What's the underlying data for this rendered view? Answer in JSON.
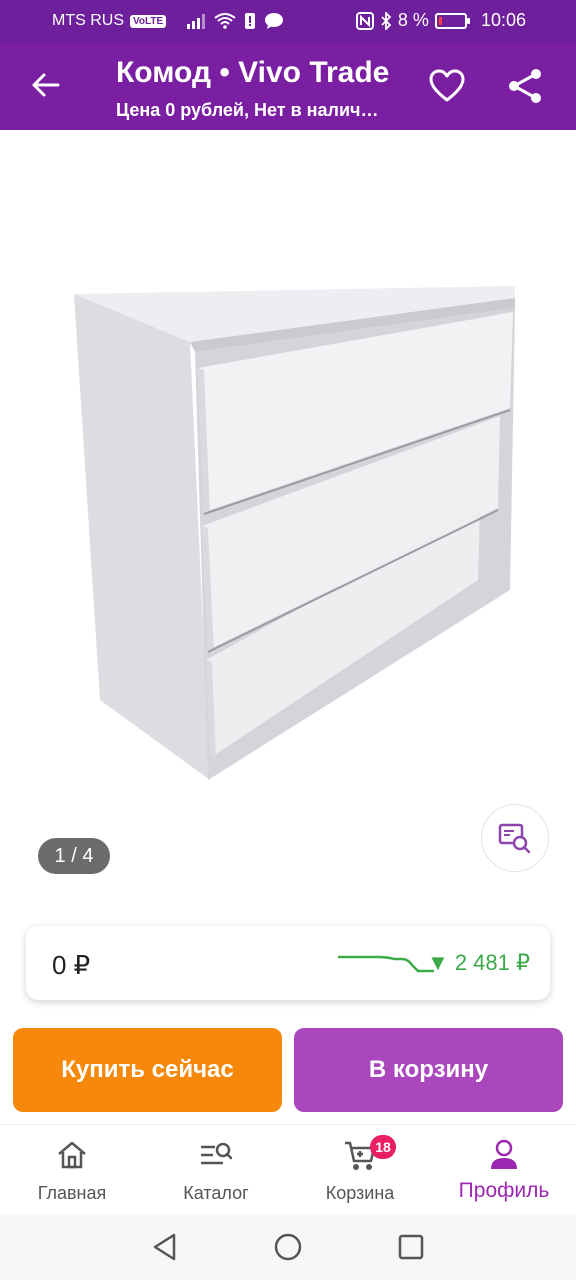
{
  "status": {
    "carrier": "MTS RUS",
    "volte": "VoLTE",
    "battery": "8 %",
    "time": "10:06"
  },
  "header": {
    "title": "Комод • Vivo Trade",
    "subtitle": "Цена 0 рублей, Нет в налич…",
    "icons": [
      "back-arrow-icon",
      "heart-icon",
      "share-icon"
    ]
  },
  "gallery": {
    "counter": "1 / 4"
  },
  "price": {
    "current": "0 ₽",
    "drop": "▼ 2 481 ₽",
    "drop_color": "#3daa4a"
  },
  "actions": {
    "buy_label": "Купить сейчас",
    "cart_label": "В корзину"
  },
  "tabs": [
    {
      "label": "Главная",
      "icon": "home-icon"
    },
    {
      "label": "Каталог",
      "icon": "catalog-search-icon"
    },
    {
      "label": "Корзина",
      "icon": "cart-icon",
      "badge": "18"
    },
    {
      "label": "Профиль",
      "icon": "profile-icon",
      "active": true
    }
  ],
  "colors": {
    "brand": "#7b1fa2",
    "buy": "#f6890b",
    "cart": "#ab47bc",
    "badge": "#e91e63"
  }
}
